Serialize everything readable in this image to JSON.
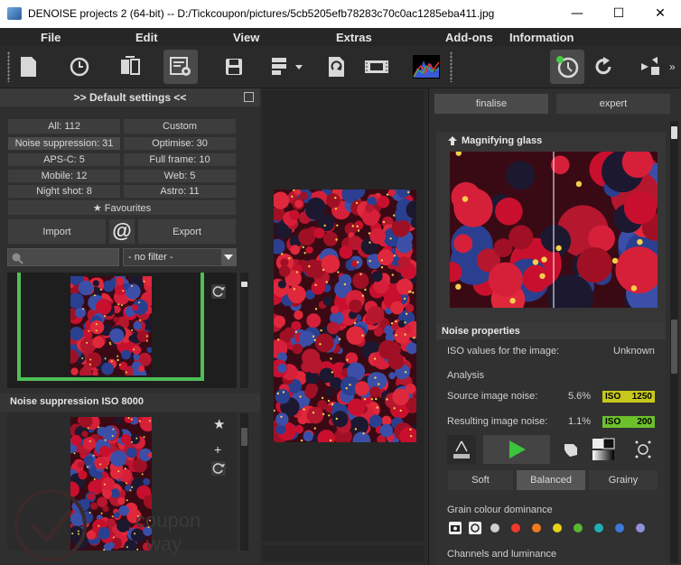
{
  "window": {
    "title": "DENOISE projects 2 (64-bit) -- D:/Tickcoupon/pictures/5cb5205efb78283c70c0ac1285eba411.jpg"
  },
  "menu": {
    "items": [
      "File",
      "Edit",
      "View",
      "Extras",
      "Add-ons",
      "Information"
    ]
  },
  "toolbar": {
    "icons": [
      "new-file-icon",
      "history-icon",
      "compare-icon",
      "settings-icon",
      "save-icon",
      "export-options-icon",
      "save-as-icon",
      "filmstrip-icon",
      "histogram-icon",
      "auto-detect-icon",
      "redo-icon",
      "fullscreen-icon"
    ],
    "overflow": "»"
  },
  "left_panel": {
    "header": ">> Default settings <<",
    "categories": {
      "all": "All: 112",
      "custom": "Custom",
      "noise": "Noise suppression: 31",
      "optimise": "Optimise: 30",
      "apsc": "APS-C: 5",
      "fullframe": "Full frame: 10",
      "mobile": "Mobile: 12",
      "web": "Web: 5",
      "nightshot": "Night shot: 8",
      "astro": "Astro: 11"
    },
    "favourites": "Favourites",
    "import": "Import",
    "at_symbol": "@",
    "export": "Export",
    "search": {
      "value": "",
      "placeholder": ""
    },
    "filter": {
      "selected": "- no filter -"
    },
    "preset2_label": "Noise suppression ISO 8000"
  },
  "right_panel": {
    "tabs": {
      "finalise": "finalise",
      "expert": "expert"
    },
    "magnifier": {
      "title": "Magnifying glass"
    },
    "noise": {
      "title": "Noise properties",
      "iso_label": "ISO values for the image:",
      "iso_value": "Unknown",
      "analysis": "Analysis",
      "source_label": "Source image noise:",
      "source_pct": "5.6%",
      "source_iso_tag": "ISO",
      "source_iso": "1250",
      "result_label": "Resulting image noise:",
      "result_pct": "1.1%",
      "result_iso_tag": "ISO",
      "result_iso": "200",
      "modes": [
        "Soft",
        "Balanced",
        "Grainy"
      ],
      "selected_mode": "Balanced",
      "grain_title": "Grain colour dominance",
      "grain_colors": [
        "#cfcfcf",
        "#ee3a2a",
        "#f07a1e",
        "#e6d21a",
        "#58b82c",
        "#1fb0b4",
        "#3a7ad8",
        "#8f8fdc"
      ],
      "channels_title": "Channels and luminance"
    }
  },
  "colors": {
    "accent_green": "#4caf50",
    "source_bar": "#c8c81a",
    "result_bar": "#6cc02c"
  }
}
